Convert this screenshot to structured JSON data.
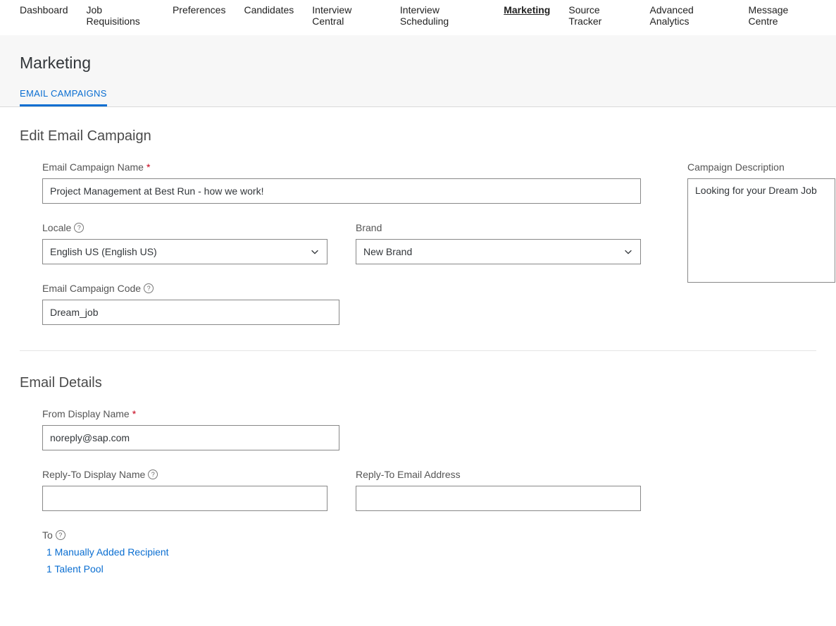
{
  "nav": {
    "items": [
      "Dashboard",
      "Job Requisitions",
      "Preferences",
      "Candidates",
      "Interview Central",
      "Interview Scheduling",
      "Marketing",
      "Source Tracker",
      "Advanced Analytics",
      "Message Centre"
    ],
    "activeIndex": 6
  },
  "header": {
    "title": "Marketing",
    "subtab": "Email Campaigns"
  },
  "section1": {
    "title": "Edit Email Campaign",
    "campaignNameLabel": "Email Campaign Name",
    "campaignNameValue": "Project Management at Best Run - how we work!",
    "localeLabel": "Locale",
    "localeValue": "English US (English US)",
    "brandLabel": "Brand",
    "brandValue": "New Brand",
    "codeLabel": "Email Campaign Code",
    "codeValue": "Dream_job",
    "descLabel": "Campaign Description",
    "descValue": "Looking for your Dream Job"
  },
  "section2": {
    "title": "Email Details",
    "fromLabel": "From Display Name",
    "fromValue": "noreply@sap.com",
    "replyNameLabel": "Reply-To Display Name",
    "replyNameValue": "",
    "replyEmailLabel": "Reply-To Email Address",
    "replyEmailValue": "",
    "toLabel": "To",
    "toLinks": [
      "1 Manually Added Recipient",
      "1 Talent Pool"
    ]
  }
}
